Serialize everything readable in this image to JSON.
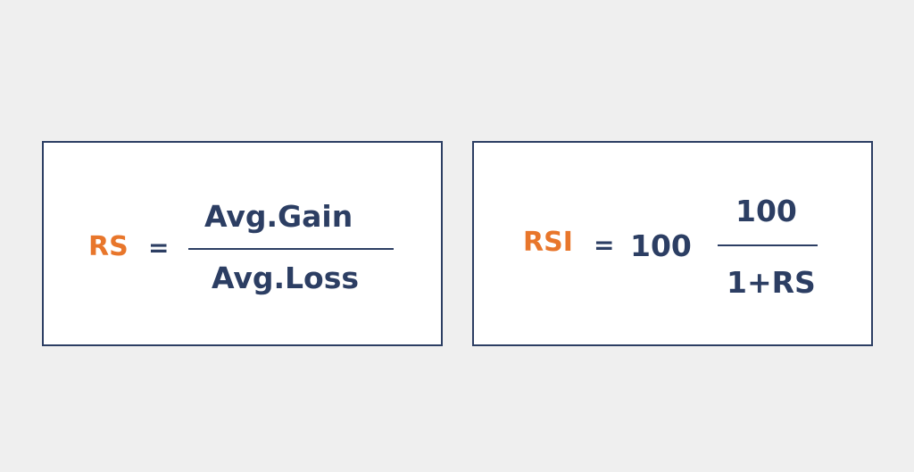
{
  "rs_formula": {
    "label": "RS",
    "equals": "=",
    "numerator": "Avg.Gain",
    "denominator": "Avg.Loss"
  },
  "rsi_formula": {
    "label": "RSI",
    "equals": "=",
    "constant": "100",
    "numerator": "100",
    "denominator": "1+RS"
  },
  "colors": {
    "background": "#efefef",
    "box_border": "#2c3e63",
    "text": "#2c3e63",
    "accent": "#e8762b"
  }
}
